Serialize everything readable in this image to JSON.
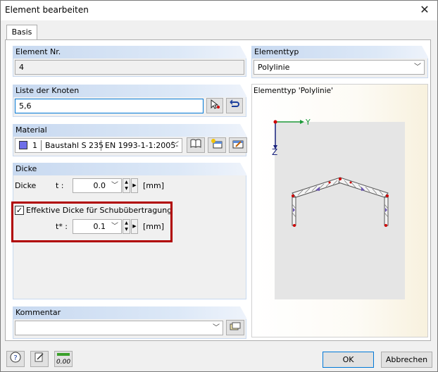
{
  "window": {
    "title": "Element bearbeiten"
  },
  "tabs": [
    {
      "label": "Basis"
    }
  ],
  "element_nr": {
    "heading": "Element Nr.",
    "value": "4"
  },
  "knoten": {
    "heading": "Liste der Knoten",
    "value": "5,6"
  },
  "material": {
    "heading": "Material",
    "color": "#6e6ee8",
    "number": "1",
    "name": "Baustahl S 235",
    "norm": "EN 1993-1-1:2005-"
  },
  "dicke": {
    "heading": "Dicke",
    "label": "Dicke",
    "symbol": "t :",
    "value": "0.0",
    "unit": "[mm]",
    "effective_label": "Effektive Dicke für Schubübertragung",
    "effective_checked": true,
    "eff_symbol": "t* :",
    "eff_value": "0.1",
    "eff_unit": "[mm]"
  },
  "kommentar": {
    "heading": "Kommentar",
    "value": ""
  },
  "elementtyp": {
    "heading": "Elementtyp",
    "value": "Polylinie"
  },
  "preview": {
    "title": "Elementtyp 'Polylinie'",
    "axis_y": "Y",
    "axis_z": "Z"
  },
  "buttons": {
    "ok": "OK",
    "cancel": "Abbrechen",
    "units_label": "0.00"
  },
  "colors": {
    "highlight": "#b00000",
    "header_blue": "#c8d9f0",
    "accent": "#0078d7"
  }
}
